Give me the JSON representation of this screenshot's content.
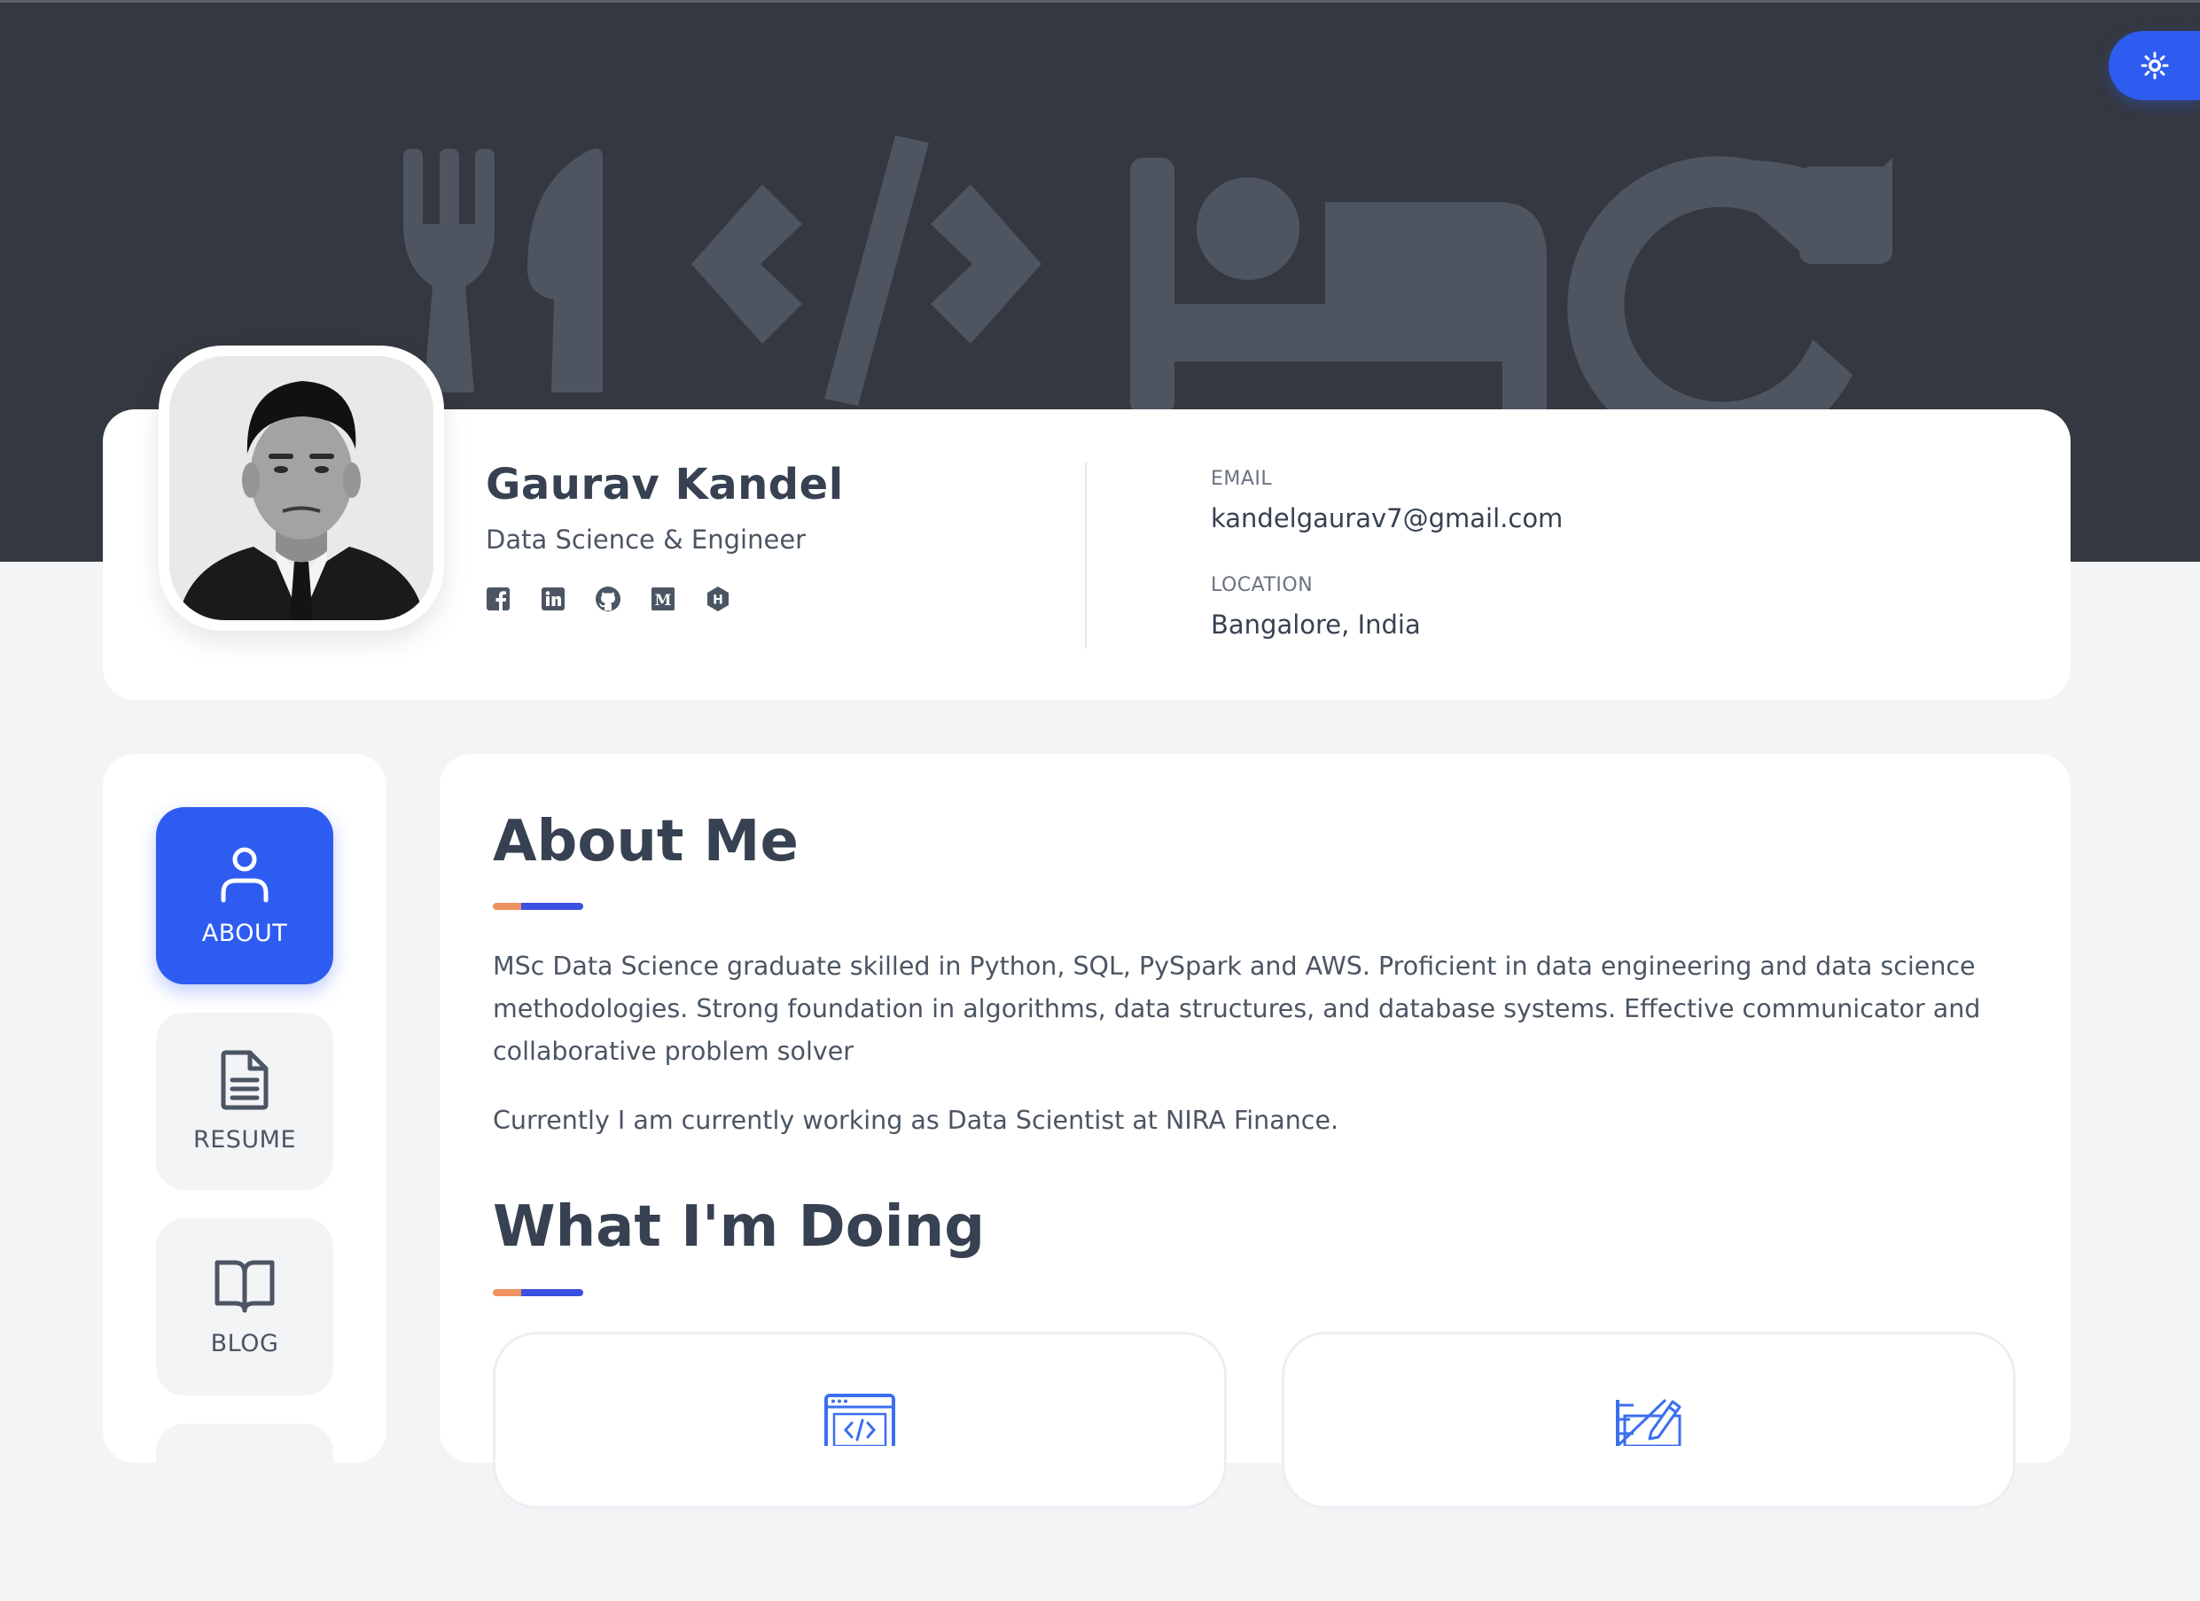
{
  "profile": {
    "name": "Gaurav Kandel",
    "role": "Data Science & Engineer",
    "socials": [
      {
        "icon": "facebook-icon"
      },
      {
        "icon": "linkedin-icon"
      },
      {
        "icon": "github-icon"
      },
      {
        "icon": "medium-icon",
        "glyph": "M"
      },
      {
        "icon": "hashnode-icon",
        "glyph": "H"
      }
    ],
    "email_label": "EMAIL",
    "email": "kandelgaurav7@gmail.com",
    "location_label": "LOCATION",
    "location": "Bangalore, India"
  },
  "hero": {
    "icons": [
      "utensils-icon",
      "code-icon",
      "bed-icon",
      "redo-icon"
    ]
  },
  "nav": {
    "items": [
      {
        "label": "ABOUT",
        "icon": "user-icon",
        "active": true
      },
      {
        "label": "RESUME",
        "icon": "document-icon",
        "active": false
      },
      {
        "label": "BLOG",
        "icon": "book-icon",
        "active": false
      }
    ]
  },
  "about": {
    "title": "About Me",
    "paragraph1": "MSc Data Science graduate skilled in Python, SQL, PySpark and AWS. Proficient in data engineering and data science methodologies. Strong foundation in algorithms, data structures, and database systems. Effective communicator and collaborative problem solver",
    "paragraph2": "Currently I am currently working as Data Scientist at NIRA Finance."
  },
  "doing": {
    "title": "What I'm Doing",
    "services": [
      {
        "icon": "web-development-icon"
      },
      {
        "icon": "design-icon"
      }
    ]
  },
  "theme": {
    "icon": "sun-icon"
  },
  "colors": {
    "accent": "#2f5cf0",
    "hero_bg": "#343840",
    "hero_icon": "#4e5560",
    "underline_orange": "#f0925f",
    "underline_blue": "#3b4fe0"
  }
}
